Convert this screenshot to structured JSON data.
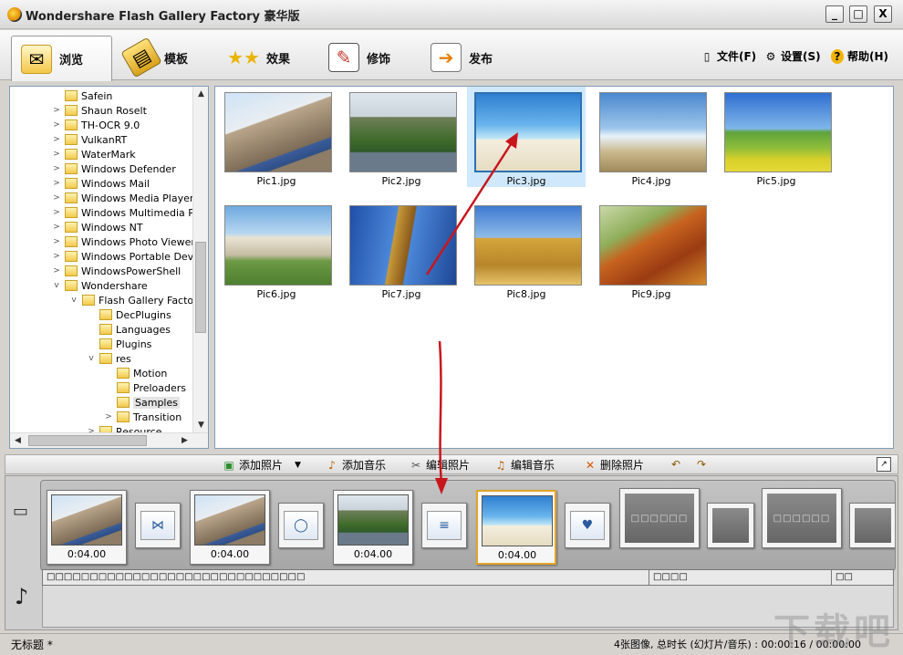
{
  "window": {
    "title": "Wondershare Flash Gallery Factory 豪华版",
    "controls": [
      "_",
      "□",
      "X"
    ]
  },
  "tabs": [
    {
      "label": "浏览",
      "icon": "envelope-icon",
      "active": true
    },
    {
      "label": "模板",
      "icon": "film-icon",
      "active": false
    },
    {
      "label": "效果",
      "icon": "stars-icon",
      "active": false
    },
    {
      "label": "修饰",
      "icon": "edit-icon",
      "active": false
    },
    {
      "label": "发布",
      "icon": "publish-icon",
      "active": false
    }
  ],
  "top_menu": {
    "file": "文件(F)",
    "settings": "设置(S)",
    "help": "帮助(H)"
  },
  "tree": {
    "items": [
      {
        "label": "Safein",
        "level": 0,
        "expander": ""
      },
      {
        "label": "Shaun Roselt",
        "level": 0,
        "expander": ">"
      },
      {
        "label": "TH-OCR 9.0",
        "level": 0,
        "expander": ">"
      },
      {
        "label": "VulkanRT",
        "level": 0,
        "expander": ">"
      },
      {
        "label": "WaterMark",
        "level": 0,
        "expander": ">"
      },
      {
        "label": "Windows Defender",
        "level": 0,
        "expander": ">"
      },
      {
        "label": "Windows Mail",
        "level": 0,
        "expander": ">"
      },
      {
        "label": "Windows Media Player",
        "level": 0,
        "expander": ">"
      },
      {
        "label": "Windows Multimedia Plat",
        "level": 0,
        "expander": ">"
      },
      {
        "label": "Windows NT",
        "level": 0,
        "expander": ">"
      },
      {
        "label": "Windows Photo Viewer",
        "level": 0,
        "expander": ">"
      },
      {
        "label": "Windows Portable Device",
        "level": 0,
        "expander": ">"
      },
      {
        "label": "WindowsPowerShell",
        "level": 0,
        "expander": ">"
      },
      {
        "label": "Wondershare",
        "level": 0,
        "expander": "v"
      },
      {
        "label": "Flash Gallery Factory",
        "level": 1,
        "expander": "v"
      },
      {
        "label": "DecPlugins",
        "level": 2,
        "expander": ""
      },
      {
        "label": "Languages",
        "level": 2,
        "expander": ""
      },
      {
        "label": "Plugins",
        "level": 2,
        "expander": ""
      },
      {
        "label": "res",
        "level": 2,
        "expander": "v"
      },
      {
        "label": "Motion",
        "level": 3,
        "expander": ""
      },
      {
        "label": "Preloaders",
        "level": 3,
        "expander": ""
      },
      {
        "label": "Samples",
        "level": 3,
        "expander": "",
        "selected": true
      },
      {
        "label": "Transition",
        "level": 3,
        "expander": ">"
      },
      {
        "label": "Resource",
        "level": 2,
        "expander": ">"
      }
    ]
  },
  "photos": [
    {
      "name": "Pic1.jpg",
      "scene": "building"
    },
    {
      "name": "Pic2.jpg",
      "scene": "castle"
    },
    {
      "name": "Pic3.jpg",
      "scene": "beach",
      "selected": true
    },
    {
      "name": "Pic4.jpg",
      "scene": "fountain"
    },
    {
      "name": "Pic5.jpg",
      "scene": "meadow"
    },
    {
      "name": "Pic6.jpg",
      "scene": "palace"
    },
    {
      "name": "Pic7.jpg",
      "scene": "statue"
    },
    {
      "name": "Pic8.jpg",
      "scene": "stupa"
    },
    {
      "name": "Pic9.jpg",
      "scene": "autumn"
    }
  ],
  "storyboard_toolbar": {
    "add_photo": "添加照片",
    "add_music": "添加音乐",
    "edit_photo": "编辑照片",
    "edit_music": "编辑音乐",
    "delete_photo": "删除照片"
  },
  "storyboard": {
    "slides": [
      {
        "scene": "building",
        "duration": "0:04.00"
      },
      {
        "scene": "building",
        "duration": "0:04.00"
      },
      {
        "scene": "castle",
        "duration": "0:04.00"
      },
      {
        "scene": "beach",
        "duration": "0:04.00",
        "selected": true
      }
    ],
    "empty_placeholder": "□□□□□□",
    "audio_track": {
      "main": "□□□□□□□□□□□□□□□□□□□□□□□□□□□□□□",
      "middle": "□□□□",
      "right": "□□"
    }
  },
  "status": {
    "left": "无标题 *",
    "right": "4张图像, 总时长 (幻灯片/音乐) : 00:00:16 / 00:00:00"
  },
  "watermark": "下载吧",
  "colors": {
    "accent_selection": "#cfe8fb",
    "arrow": "#c8161d",
    "slide_selected": "#e1a52a"
  }
}
